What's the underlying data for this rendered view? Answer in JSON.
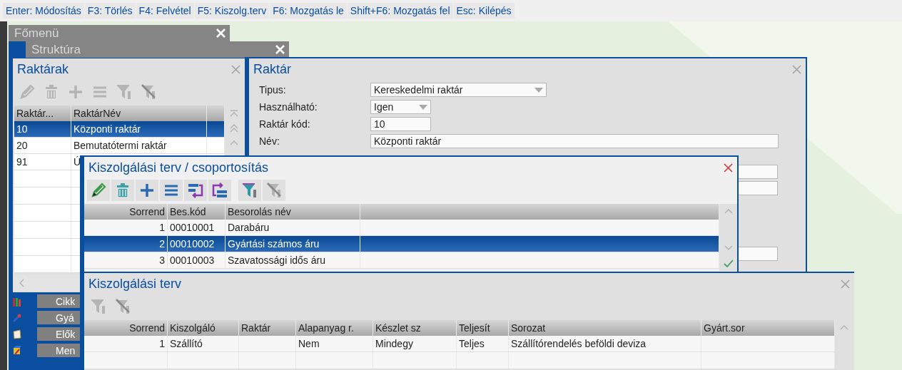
{
  "shortcut_bar": [
    "Enter: Módosítás",
    "F3: Törlés",
    "F4: Felvétel",
    "F5: Kiszolg.terv",
    "F6: Mozgatás le",
    "Shift+F6: Mozgatás fel",
    "Esc: Kilépés"
  ],
  "main_menu": {
    "title": "Főmenü",
    "items": [
      {
        "label": "Cikk",
        "kind": "bars"
      },
      {
        "label": "Gyá",
        "kind": "tools"
      },
      {
        "label": "Elők",
        "kind": "document"
      },
      {
        "label": "Men",
        "kind": "cube"
      }
    ]
  },
  "structure": {
    "title": "Struktúra"
  },
  "warehouses": {
    "title": "Raktárak",
    "toolbar": [
      {
        "kind": "edit",
        "disabled": true
      },
      {
        "kind": "delete",
        "disabled": true
      },
      {
        "kind": "add",
        "disabled": true
      },
      {
        "kind": "list",
        "disabled": true
      },
      {
        "kind": "filter",
        "disabled": true
      },
      {
        "kind": "filter-clear",
        "disabled": true
      }
    ],
    "columns": [
      "Raktár...",
      "RaktárNév"
    ],
    "rows": [
      {
        "cells": [
          "10",
          "Központi raktár"
        ],
        "selected": true
      },
      {
        "cells": [
          "20",
          "Bemutatótermi raktár"
        ],
        "selected": false
      },
      {
        "cells": [
          "91",
          "Ú"
        ],
        "selected": false
      }
    ]
  },
  "warehouse": {
    "title": "Raktár",
    "fields": [
      {
        "label": "Tipus:",
        "kind": "dropdown",
        "value": "Kereskedelmi raktár"
      },
      {
        "label": "Használható:",
        "kind": "dropdown",
        "value": "Igen"
      },
      {
        "label": "Raktár kód:",
        "kind": "text",
        "value": "10"
      },
      {
        "label": "Név:",
        "kind": "text",
        "value": "Központi raktár"
      }
    ]
  },
  "grouping_dialog": {
    "title": "Kiszolgálási terv / csoportosítás",
    "toolbar": [
      {
        "kind": "edit",
        "disabled": false
      },
      {
        "kind": "delete",
        "disabled": false
      },
      {
        "kind": "add",
        "disabled": false
      },
      {
        "kind": "list",
        "disabled": false
      },
      {
        "kind": "move-down",
        "disabled": false
      },
      {
        "kind": "move-up",
        "disabled": false
      },
      {
        "kind": "filter",
        "disabled": false
      },
      {
        "kind": "filter-clear",
        "disabled": true
      }
    ],
    "columns": [
      "Sorrend",
      "Bes.kód",
      "Besorolás név"
    ],
    "rows": [
      {
        "cells": [
          "1",
          "00010001",
          "Darabáru"
        ],
        "selected": false
      },
      {
        "cells": [
          "2",
          "00010002",
          "Gyártási számos áru"
        ],
        "selected": true
      },
      {
        "cells": [
          "3",
          "00010003",
          "Szavatossági idős áru"
        ],
        "selected": false
      }
    ]
  },
  "service_plan": {
    "title": "Kiszolgálási terv",
    "toolbar": [
      {
        "kind": "filter",
        "disabled": true
      },
      {
        "kind": "filter-clear",
        "disabled": true
      }
    ],
    "columns": [
      "Sorrend",
      "Kiszolgáló",
      "Raktár",
      "Alapanyag r.",
      "Készlet sz",
      "Teljesít",
      "Sorozat",
      "Gyárt.sor"
    ],
    "rows": [
      {
        "cells": [
          "1",
          "Szállító",
          "",
          "Nem",
          "Mindegy",
          "Teljes",
          "Szállítórendelés beföldi deviza",
          ""
        ],
        "selected": false
      }
    ]
  }
}
